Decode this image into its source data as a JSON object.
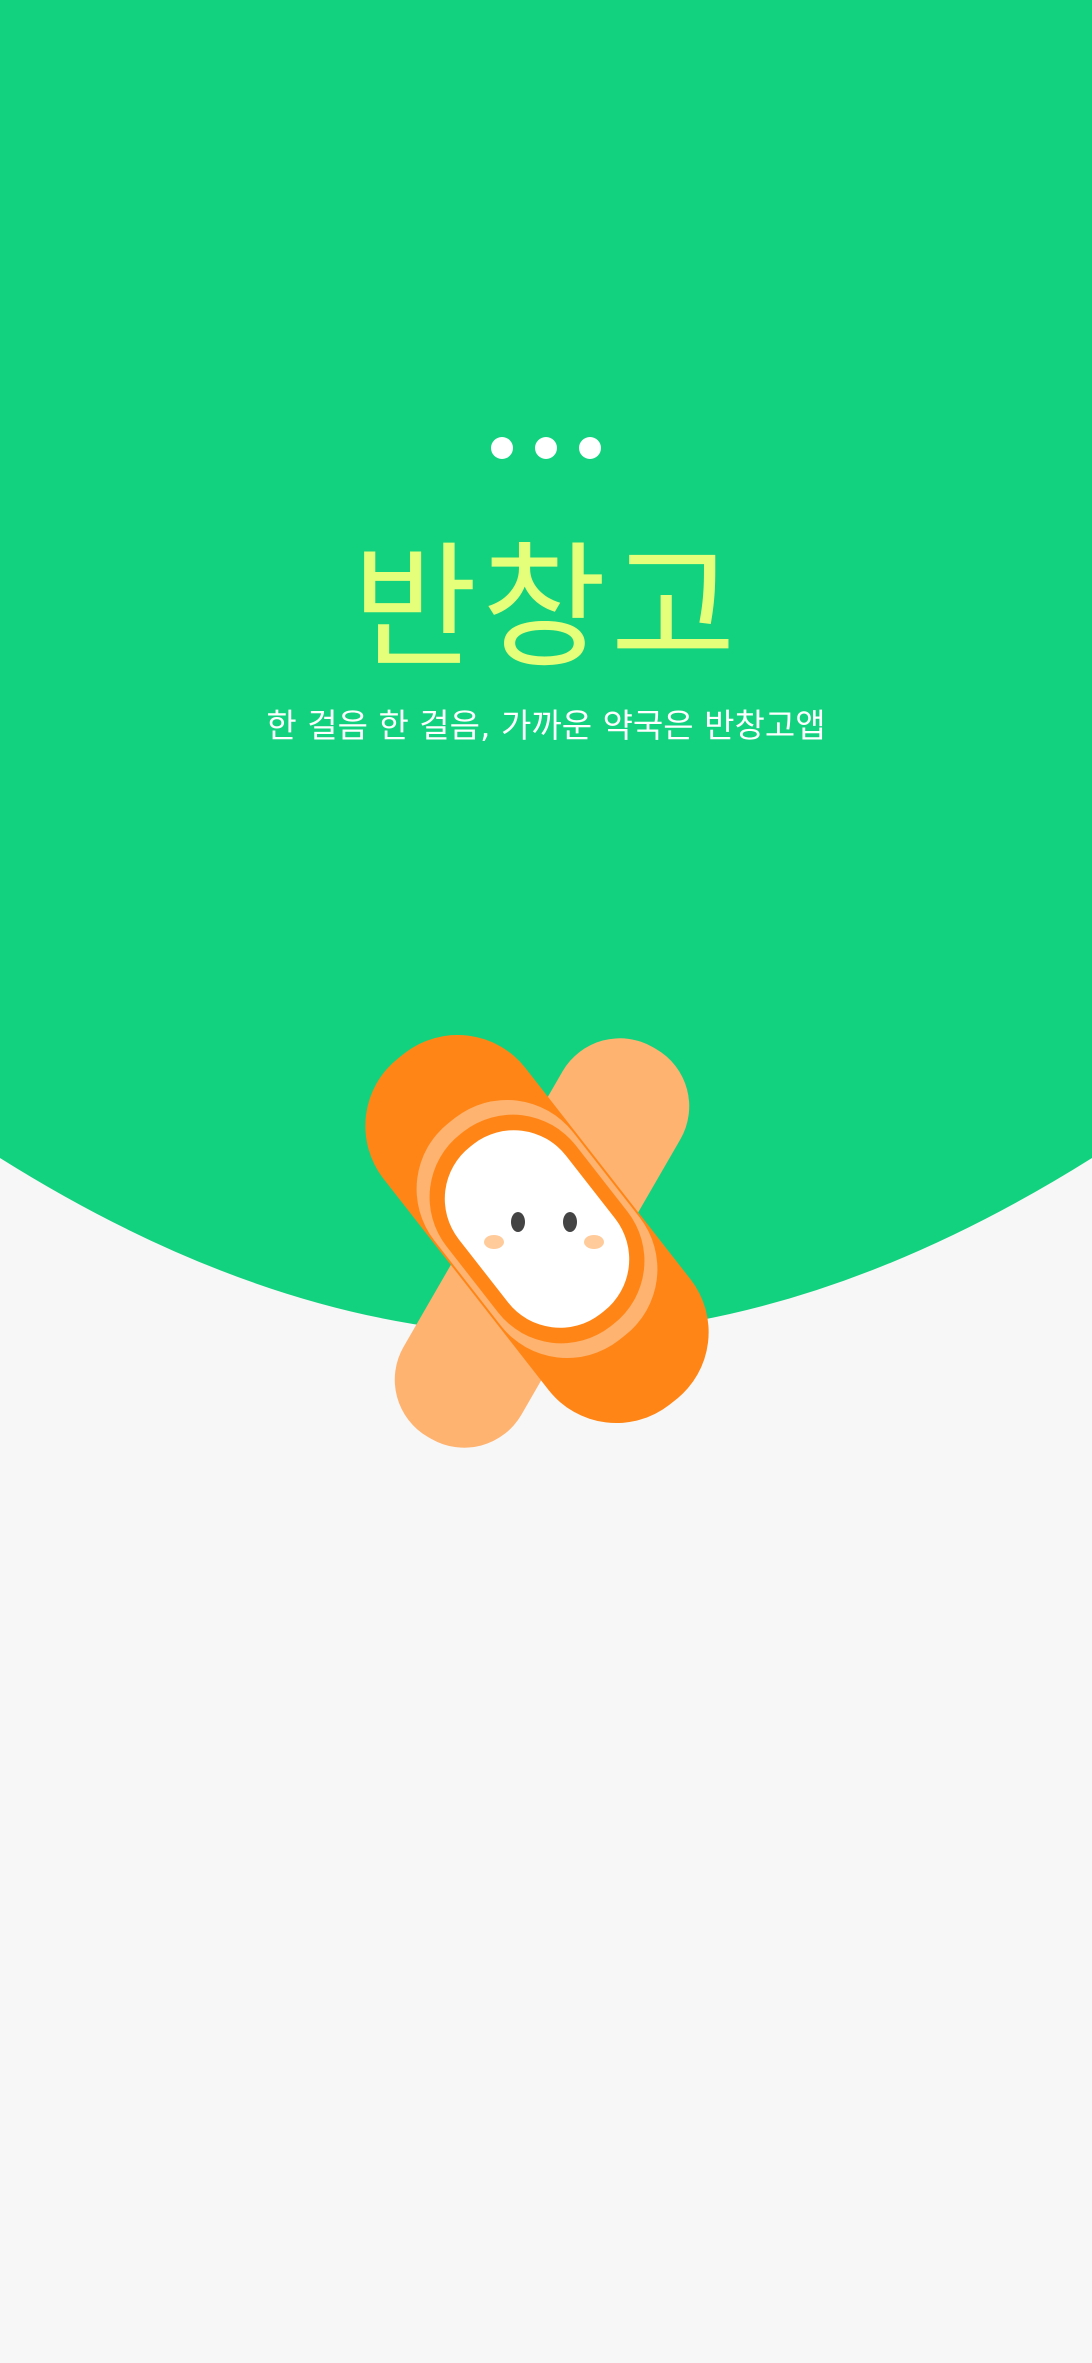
{
  "splash": {
    "title": "반창고",
    "tagline": "한 걸음 한 걸음, 가까운 약국은 반창고앱",
    "loading_indicator": "three-dots",
    "mascot": "bandage-mascot-icon"
  },
  "colors": {
    "primary_green": "#12D27F",
    "title_yellow": "#E5FF7A",
    "background": "#F7F7F7",
    "bandage_dark_orange": "#FF8616",
    "bandage_light_orange": "#FFB370",
    "bandage_pad": "#FFFFFF"
  }
}
